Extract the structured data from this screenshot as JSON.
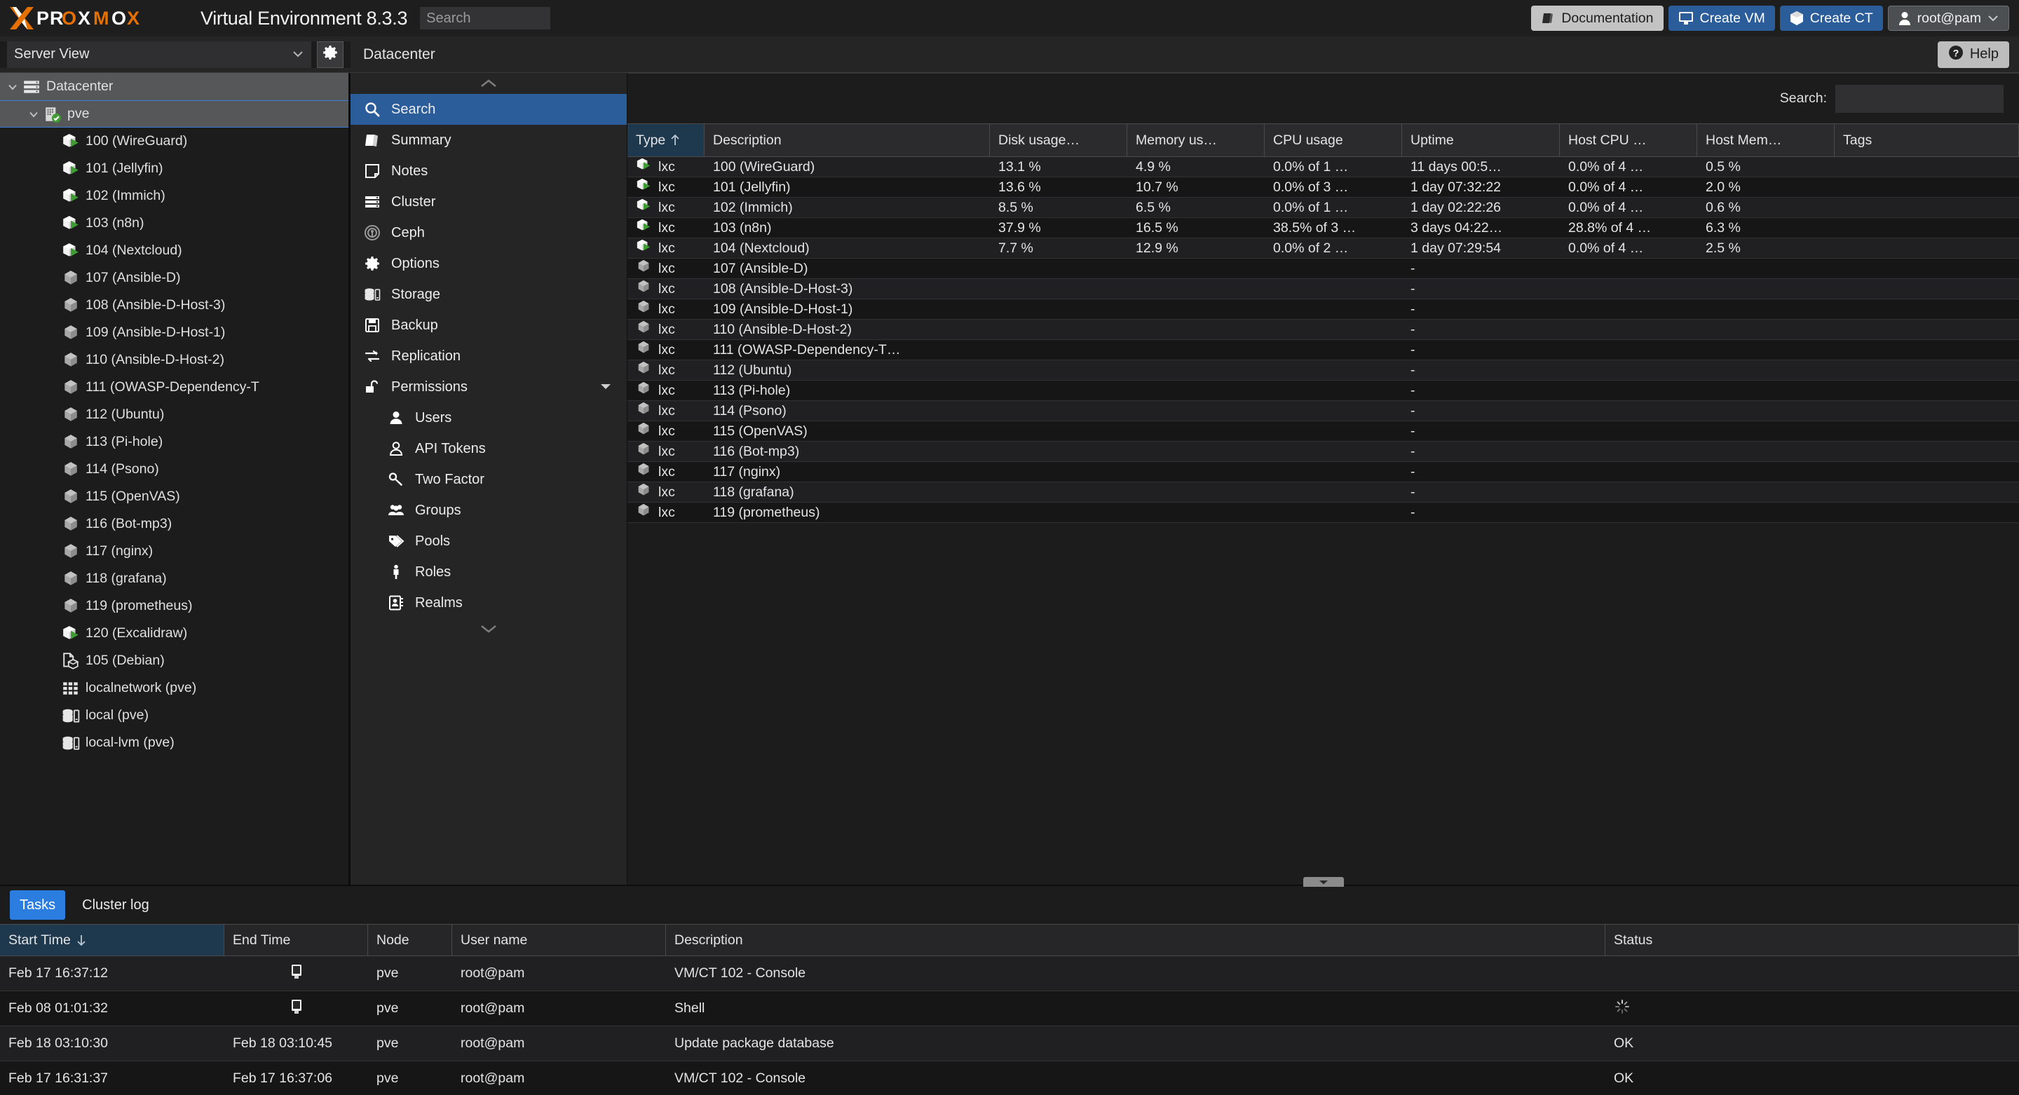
{
  "brand": {
    "name": "PROXMOX",
    "product": "Virtual Environment 8.3.3"
  },
  "topbar": {
    "search_placeholder": "Search",
    "search_value": "",
    "documentation_label": "Documentation",
    "create_vm_label": "Create VM",
    "create_ct_label": "Create CT",
    "user_label": "root@pam",
    "accent_blue": "#2b5d9b",
    "brand_orange": "#e57000"
  },
  "secondbar": {
    "view_selector": "Server View",
    "breadcrumb": "Datacenter",
    "help_label": "Help"
  },
  "tree": {
    "items": [
      {
        "label": "Datacenter",
        "icon": "datacenter-icon",
        "level": 0,
        "expanded": true,
        "selected": false
      },
      {
        "label": "pve",
        "icon": "node-online-icon",
        "level": 1,
        "expanded": true,
        "selected": true
      },
      {
        "label": "100 (WireGuard)",
        "icon": "ct-running-icon",
        "level": 2
      },
      {
        "label": "101 (Jellyfin)",
        "icon": "ct-running-icon",
        "level": 2
      },
      {
        "label": "102 (Immich)",
        "icon": "ct-running-icon",
        "level": 2
      },
      {
        "label": "103 (n8n)",
        "icon": "ct-running-icon",
        "level": 2
      },
      {
        "label": "104 (Nextcloud)",
        "icon": "ct-running-icon",
        "level": 2
      },
      {
        "label": "107 (Ansible-D)",
        "icon": "ct-stopped-icon",
        "level": 2
      },
      {
        "label": "108 (Ansible-D-Host-3)",
        "icon": "ct-stopped-icon",
        "level": 2
      },
      {
        "label": "109 (Ansible-D-Host-1)",
        "icon": "ct-stopped-icon",
        "level": 2
      },
      {
        "label": "110 (Ansible-D-Host-2)",
        "icon": "ct-stopped-icon",
        "level": 2
      },
      {
        "label": "111 (OWASP-Dependency-T",
        "icon": "ct-stopped-icon",
        "level": 2
      },
      {
        "label": "112 (Ubuntu)",
        "icon": "ct-stopped-icon",
        "level": 2
      },
      {
        "label": "113 (Pi-hole)",
        "icon": "ct-stopped-icon",
        "level": 2
      },
      {
        "label": "114 (Psono)",
        "icon": "ct-stopped-icon",
        "level": 2
      },
      {
        "label": "115 (OpenVAS)",
        "icon": "ct-stopped-icon",
        "level": 2
      },
      {
        "label": "116 (Bot-mp3)",
        "icon": "ct-stopped-icon",
        "level": 2
      },
      {
        "label": "117 (nginx)",
        "icon": "ct-stopped-icon",
        "level": 2
      },
      {
        "label": "118 (grafana)",
        "icon": "ct-stopped-icon",
        "level": 2
      },
      {
        "label": "119 (prometheus)",
        "icon": "ct-stopped-icon",
        "level": 2
      },
      {
        "label": "120 (Excalidraw)",
        "icon": "ct-running-icon",
        "level": 2
      },
      {
        "label": "105 (Debian)",
        "icon": "template-icon",
        "level": 2
      },
      {
        "label": "localnetwork (pve)",
        "icon": "network-icon",
        "level": 2
      },
      {
        "label": "local (pve)",
        "icon": "storage-icon",
        "level": 2
      },
      {
        "label": "local-lvm (pve)",
        "icon": "storage-icon",
        "level": 2
      }
    ]
  },
  "menu": {
    "items": [
      {
        "label": "Search",
        "icon": "search-icon",
        "active": true,
        "sub": false
      },
      {
        "label": "Summary",
        "icon": "book-icon",
        "active": false,
        "sub": false
      },
      {
        "label": "Notes",
        "icon": "note-icon",
        "active": false,
        "sub": false
      },
      {
        "label": "Cluster",
        "icon": "cluster-icon",
        "active": false,
        "sub": false
      },
      {
        "label": "Ceph",
        "icon": "ceph-icon",
        "active": false,
        "sub": false
      },
      {
        "label": "Options",
        "icon": "gear-icon",
        "active": false,
        "sub": false
      },
      {
        "label": "Storage",
        "icon": "storage-icon",
        "active": false,
        "sub": false
      },
      {
        "label": "Backup",
        "icon": "floppy-icon",
        "active": false,
        "sub": false
      },
      {
        "label": "Replication",
        "icon": "replication-icon",
        "active": false,
        "sub": false
      },
      {
        "label": "Permissions",
        "icon": "unlock-icon",
        "active": false,
        "sub": false,
        "expander": true
      },
      {
        "label": "Users",
        "icon": "user-icon",
        "active": false,
        "sub": true
      },
      {
        "label": "API Tokens",
        "icon": "api-token-icon",
        "active": false,
        "sub": true
      },
      {
        "label": "Two Factor",
        "icon": "key-icon",
        "active": false,
        "sub": true
      },
      {
        "label": "Groups",
        "icon": "groups-icon",
        "active": false,
        "sub": true
      },
      {
        "label": "Pools",
        "icon": "tag-icon",
        "active": false,
        "sub": true
      },
      {
        "label": "Roles",
        "icon": "role-icon",
        "active": false,
        "sub": true
      },
      {
        "label": "Realms",
        "icon": "realm-icon",
        "active": false,
        "sub": true
      }
    ]
  },
  "search_panel": {
    "label": "Search:",
    "value": "",
    "placeholder": ""
  },
  "resource_grid": {
    "columns": [
      {
        "key": "type",
        "label": "Type",
        "sorted": true,
        "sort_dir": "asc"
      },
      {
        "key": "desc",
        "label": "Description",
        "sorted": false
      },
      {
        "key": "disk",
        "label": "Disk usage…",
        "sorted": false
      },
      {
        "key": "mem",
        "label": "Memory us…",
        "sorted": false
      },
      {
        "key": "cpu",
        "label": "CPU usage",
        "sorted": false
      },
      {
        "key": "up",
        "label": "Uptime",
        "sorted": false
      },
      {
        "key": "hcpu",
        "label": "Host CPU …",
        "sorted": false
      },
      {
        "key": "hmem",
        "label": "Host Mem…",
        "sorted": false
      },
      {
        "key": "tags",
        "label": "Tags",
        "sorted": false
      }
    ],
    "rows": [
      {
        "icon": "ct-running-icon",
        "type": "lxc",
        "desc": "100 (WireGuard)",
        "disk": "13.1 %",
        "mem": "4.9 %",
        "cpu": "0.0% of 1 …",
        "up": "11 days 00:5…",
        "hcpu": "0.0% of 4 …",
        "hmem": "0.5 %",
        "tags": ""
      },
      {
        "icon": "ct-running-icon",
        "type": "lxc",
        "desc": "101 (Jellyfin)",
        "disk": "13.6 %",
        "mem": "10.7 %",
        "cpu": "0.0% of 3 …",
        "up": "1 day 07:32:22",
        "hcpu": "0.0% of 4 …",
        "hmem": "2.0 %",
        "tags": ""
      },
      {
        "icon": "ct-running-icon",
        "type": "lxc",
        "desc": "102 (Immich)",
        "disk": "8.5 %",
        "mem": "6.5 %",
        "cpu": "0.0% of 1 …",
        "up": "1 day 02:22:26",
        "hcpu": "0.0% of 4 …",
        "hmem": "0.6 %",
        "tags": ""
      },
      {
        "icon": "ct-running-icon",
        "type": "lxc",
        "desc": "103 (n8n)",
        "disk": "37.9 %",
        "mem": "16.5 %",
        "cpu": "38.5% of 3 …",
        "up": "3 days 04:22…",
        "hcpu": "28.8% of 4 …",
        "hmem": "6.3 %",
        "tags": ""
      },
      {
        "icon": "ct-running-icon",
        "type": "lxc",
        "desc": "104 (Nextcloud)",
        "disk": "7.7 %",
        "mem": "12.9 %",
        "cpu": "0.0% of 2 …",
        "up": "1 day 07:29:54",
        "hcpu": "0.0% of 4 …",
        "hmem": "2.5 %",
        "tags": ""
      },
      {
        "icon": "ct-stopped-icon",
        "type": "lxc",
        "desc": "107 (Ansible-D)",
        "disk": "",
        "mem": "",
        "cpu": "",
        "up": "-",
        "hcpu": "",
        "hmem": "",
        "tags": ""
      },
      {
        "icon": "ct-stopped-icon",
        "type": "lxc",
        "desc": "108 (Ansible-D-Host-3)",
        "disk": "",
        "mem": "",
        "cpu": "",
        "up": "-",
        "hcpu": "",
        "hmem": "",
        "tags": ""
      },
      {
        "icon": "ct-stopped-icon",
        "type": "lxc",
        "desc": "109 (Ansible-D-Host-1)",
        "disk": "",
        "mem": "",
        "cpu": "",
        "up": "-",
        "hcpu": "",
        "hmem": "",
        "tags": ""
      },
      {
        "icon": "ct-stopped-icon",
        "type": "lxc",
        "desc": "110 (Ansible-D-Host-2)",
        "disk": "",
        "mem": "",
        "cpu": "",
        "up": "-",
        "hcpu": "",
        "hmem": "",
        "tags": ""
      },
      {
        "icon": "ct-stopped-icon",
        "type": "lxc",
        "desc": "111 (OWASP-Dependency-T…",
        "disk": "",
        "mem": "",
        "cpu": "",
        "up": "-",
        "hcpu": "",
        "hmem": "",
        "tags": ""
      },
      {
        "icon": "ct-stopped-icon",
        "type": "lxc",
        "desc": "112 (Ubuntu)",
        "disk": "",
        "mem": "",
        "cpu": "",
        "up": "-",
        "hcpu": "",
        "hmem": "",
        "tags": ""
      },
      {
        "icon": "ct-stopped-icon",
        "type": "lxc",
        "desc": "113 (Pi-hole)",
        "disk": "",
        "mem": "",
        "cpu": "",
        "up": "-",
        "hcpu": "",
        "hmem": "",
        "tags": ""
      },
      {
        "icon": "ct-stopped-icon",
        "type": "lxc",
        "desc": "114 (Psono)",
        "disk": "",
        "mem": "",
        "cpu": "",
        "up": "-",
        "hcpu": "",
        "hmem": "",
        "tags": ""
      },
      {
        "icon": "ct-stopped-icon",
        "type": "lxc",
        "desc": "115 (OpenVAS)",
        "disk": "",
        "mem": "",
        "cpu": "",
        "up": "-",
        "hcpu": "",
        "hmem": "",
        "tags": ""
      },
      {
        "icon": "ct-stopped-icon",
        "type": "lxc",
        "desc": "116 (Bot-mp3)",
        "disk": "",
        "mem": "",
        "cpu": "",
        "up": "-",
        "hcpu": "",
        "hmem": "",
        "tags": ""
      },
      {
        "icon": "ct-stopped-icon",
        "type": "lxc",
        "desc": "117 (nginx)",
        "disk": "",
        "mem": "",
        "cpu": "",
        "up": "-",
        "hcpu": "",
        "hmem": "",
        "tags": ""
      },
      {
        "icon": "ct-stopped-icon",
        "type": "lxc",
        "desc": "118 (grafana)",
        "disk": "",
        "mem": "",
        "cpu": "",
        "up": "-",
        "hcpu": "",
        "hmem": "",
        "tags": ""
      },
      {
        "icon": "ct-stopped-icon",
        "type": "lxc",
        "desc": "119 (prometheus)",
        "disk": "",
        "mem": "",
        "cpu": "",
        "up": "-",
        "hcpu": "",
        "hmem": "",
        "tags": ""
      }
    ]
  },
  "bottom_panel": {
    "tabs": [
      {
        "label": "Tasks",
        "active": true
      },
      {
        "label": "Cluster log",
        "active": false
      }
    ],
    "columns": [
      {
        "key": "start",
        "label": "Start Time",
        "sorted": true,
        "sort_dir": "desc"
      },
      {
        "key": "end",
        "label": "End Time",
        "sorted": false
      },
      {
        "key": "node",
        "label": "Node",
        "sorted": false
      },
      {
        "key": "user",
        "label": "User name",
        "sorted": false
      },
      {
        "key": "desc",
        "label": "Description",
        "sorted": false
      },
      {
        "key": "status",
        "label": "Status",
        "sorted": false
      }
    ],
    "rows": [
      {
        "start": "Feb 17 16:37:12",
        "end": "",
        "end_icon": "console-icon",
        "node": "pve",
        "user": "root@pam",
        "desc": "VM/CT 102 - Console",
        "status": "",
        "status_icon": ""
      },
      {
        "start": "Feb 08 01:01:32",
        "end": "",
        "end_icon": "console-icon",
        "node": "pve",
        "user": "root@pam",
        "desc": "Shell",
        "status": "",
        "status_icon": "spinner-icon"
      },
      {
        "start": "Feb 18 03:10:30",
        "end": "Feb 18 03:10:45",
        "end_icon": "",
        "node": "pve",
        "user": "root@pam",
        "desc": "Update package database",
        "status": "OK",
        "status_icon": ""
      },
      {
        "start": "Feb 17 16:31:37",
        "end": "Feb 17 16:37:06",
        "end_icon": "",
        "node": "pve",
        "user": "root@pam",
        "desc": "VM/CT 102 - Console",
        "status": "OK",
        "status_icon": ""
      }
    ]
  }
}
